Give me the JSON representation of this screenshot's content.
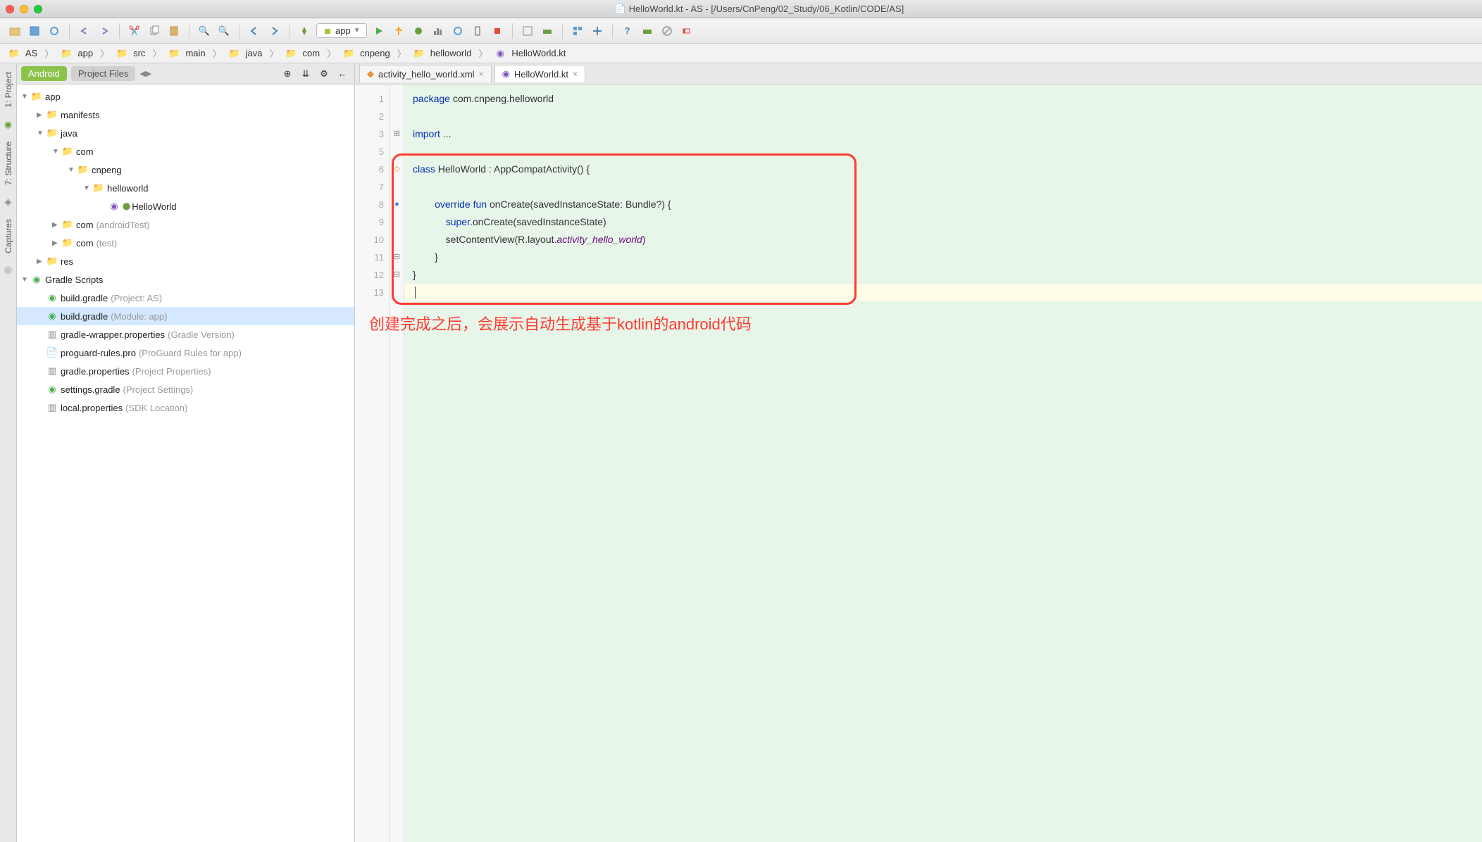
{
  "title": "HelloWorld.kt - AS - [/Users/CnPeng/02_Study/06_Kotlin/CODE/AS]",
  "runConfig": {
    "label": "app"
  },
  "breadcrumbs": [
    "AS",
    "app",
    "src",
    "main",
    "java",
    "com",
    "cnpeng",
    "helloworld",
    "HelloWorld.kt"
  ],
  "panel": {
    "tab_android": "Android",
    "tab_files": "Project Files"
  },
  "rails": {
    "project": "1: Project",
    "structure": "7: Structure",
    "captures": "Captures"
  },
  "tree": {
    "app": "app",
    "manifests": "manifests",
    "java": "java",
    "com": "com",
    "cnpeng": "cnpeng",
    "helloworld": "helloworld",
    "HelloWorld": "HelloWorld",
    "com_androidTest": "com",
    "com_androidTest_suffix": "(androidTest)",
    "com_test": "com",
    "com_test_suffix": "(test)",
    "res": "res",
    "gradle_scripts": "Gradle Scripts",
    "build_gradle_project": "build.gradle",
    "build_gradle_project_suffix": "(Project: AS)",
    "build_gradle_module": "build.gradle",
    "build_gradle_module_suffix": "(Module: app)",
    "gradle_wrapper": "gradle-wrapper.properties",
    "gradle_wrapper_suffix": "(Gradle Version)",
    "proguard": "proguard-rules.pro",
    "proguard_suffix": "(ProGuard Rules for app)",
    "gradle_props": "gradle.properties",
    "gradle_props_suffix": "(Project Properties)",
    "settings_gradle": "settings.gradle",
    "settings_gradle_suffix": "(Project Settings)",
    "local_props": "local.properties",
    "local_props_suffix": "(SDK Location)"
  },
  "editorTabs": {
    "xml": "activity_hello_world.xml",
    "kt": "HelloWorld.kt"
  },
  "code": {
    "lineNumbers": [
      "1",
      "2",
      "3",
      "5",
      "6",
      "7",
      "8",
      "9",
      "10",
      "11",
      "12",
      "13"
    ],
    "l1_kw": "package",
    "l1_rest": " com.cnpeng.helloworld",
    "l3_kw": "import",
    "l3_rest": " ...",
    "l6_kw": "class",
    "l6_rest": " HelloWorld : AppCompatActivity() {",
    "l8_kw1": "override",
    "l8_kw2": "fun",
    "l8_rest": " onCreate(savedInstanceState: Bundle?) {",
    "l9_kw": "super",
    "l9_rest": ".onCreate(savedInstanceState)",
    "l10_a": "            setContentView(R.layout.",
    "l10_it": "activity_hello_world",
    "l10_b": ")",
    "l11": "        }",
    "l12": "}",
    "indent8": "        ",
    "indent12": "            "
  },
  "annotation": "创建完成之后，会展示自动生成基于kotlin的android代码"
}
